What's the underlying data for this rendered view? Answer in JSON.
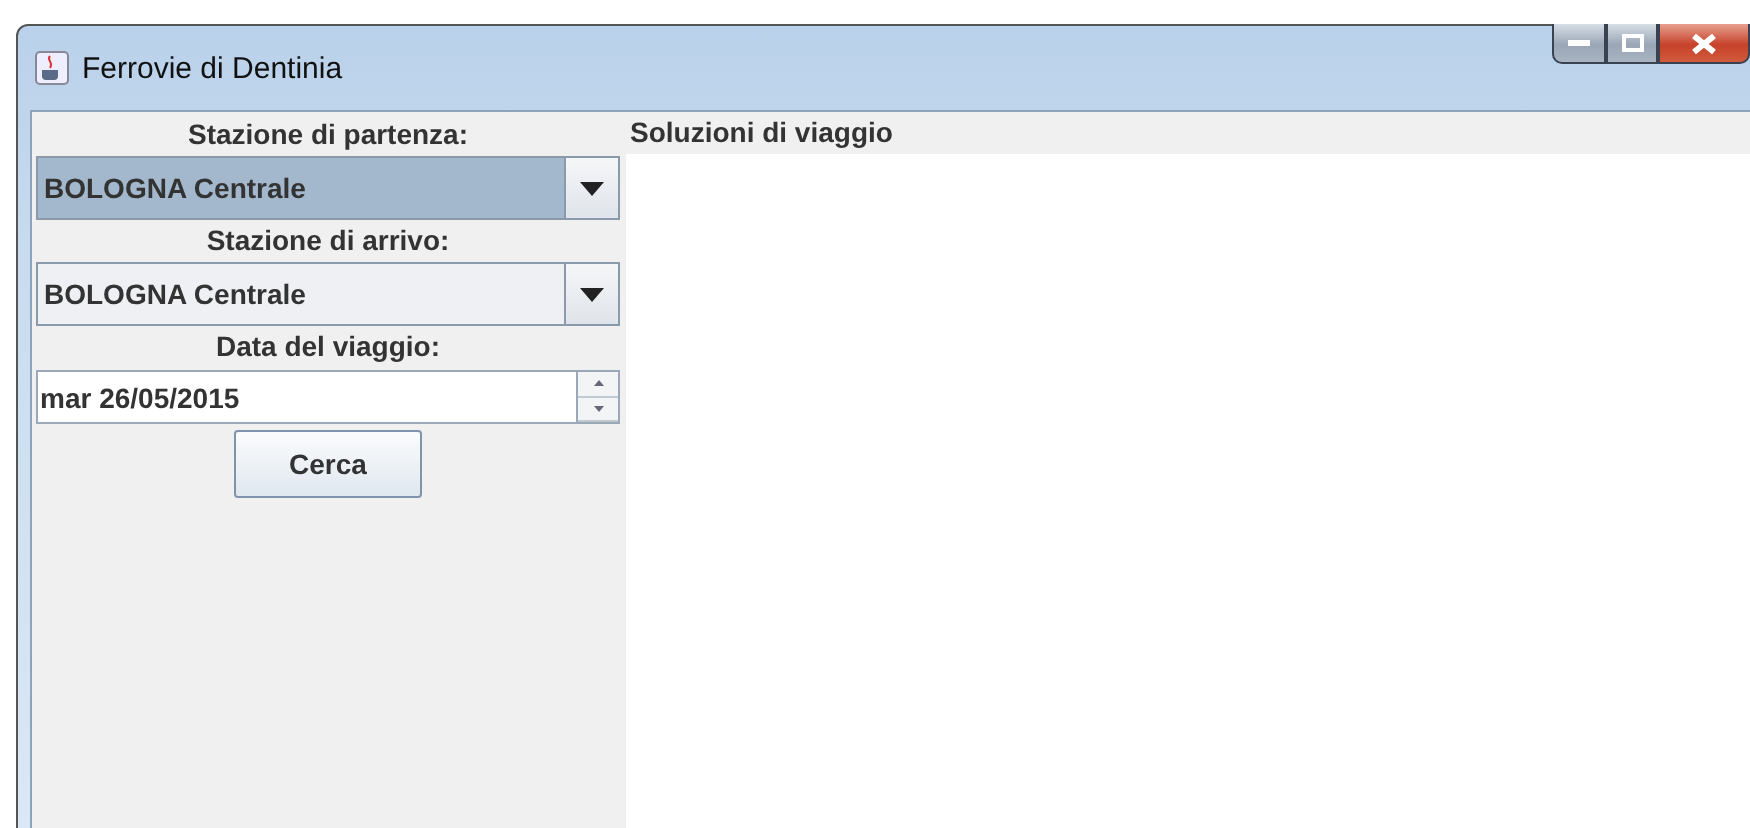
{
  "window": {
    "title": "Ferrovie di Dentinia"
  },
  "form": {
    "fields": [
      {
        "kind": "combo",
        "label": "Stazione di partenza:",
        "value": "BOLOGNA Centrale",
        "focused": true
      },
      {
        "kind": "combo",
        "label": "Stazione di arrivo:",
        "value": "BOLOGNA Centrale",
        "focused": false
      },
      {
        "kind": "spinner",
        "label": "Data del viaggio:",
        "value": "mar 26/05/2015",
        "focused": false
      }
    ],
    "button": "Cerca"
  },
  "results": {
    "title": "Soluzioni di viaggio"
  }
}
